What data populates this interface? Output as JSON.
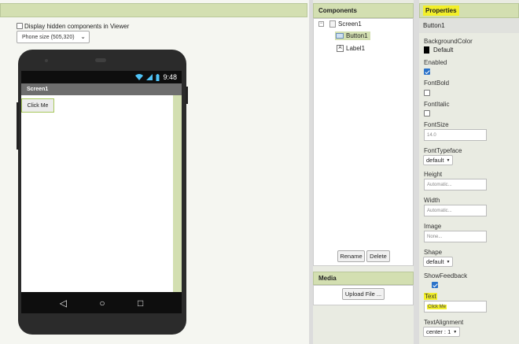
{
  "viewer": {
    "hidden_components_label": "Display hidden components in Viewer",
    "hidden_components_checked": false,
    "phone_size": "Phone size (505,320)"
  },
  "phone": {
    "time": "9:48",
    "screen_title": "Screen1",
    "button_text": "Click Me",
    "nav_back": "◁",
    "nav_home": "○",
    "nav_recents": "□"
  },
  "components": {
    "header": "Components",
    "tree": {
      "root": "Screen1",
      "children": [
        "Button1",
        "Label1"
      ]
    },
    "rename_label": "Rename",
    "delete_label": "Delete"
  },
  "media": {
    "header": "Media",
    "upload_label": "Upload File ..."
  },
  "properties": {
    "header": "Properties",
    "selected": "Button1",
    "background_color_label": "BackgroundColor",
    "background_color_value": "Default",
    "enabled_label": "Enabled",
    "enabled": true,
    "fontbold_label": "FontBold",
    "fontbold": false,
    "fontitalic_label": "FontItalic",
    "fontitalic": false,
    "fontsize_label": "FontSize",
    "fontsize_value": "14.0",
    "fonttypeface_label": "FontTypeface",
    "fonttypeface_value": "default",
    "height_label": "Height",
    "height_value": "Automatic...",
    "width_label": "Width",
    "width_value": "Automatic...",
    "image_label": "Image",
    "image_value": "None...",
    "shape_label": "Shape",
    "shape_value": "default",
    "showfeedback_label": "ShowFeedback",
    "showfeedback": true,
    "text_label": "Text",
    "text_value": "Click Me",
    "textalignment_label": "TextAlignment",
    "textalignment_value": "center : 1"
  },
  "colors": {
    "accent_green": "#d3dfb1",
    "highlight_yellow": "#f2ef2a",
    "checkbox_blue": "#2a72c9"
  }
}
